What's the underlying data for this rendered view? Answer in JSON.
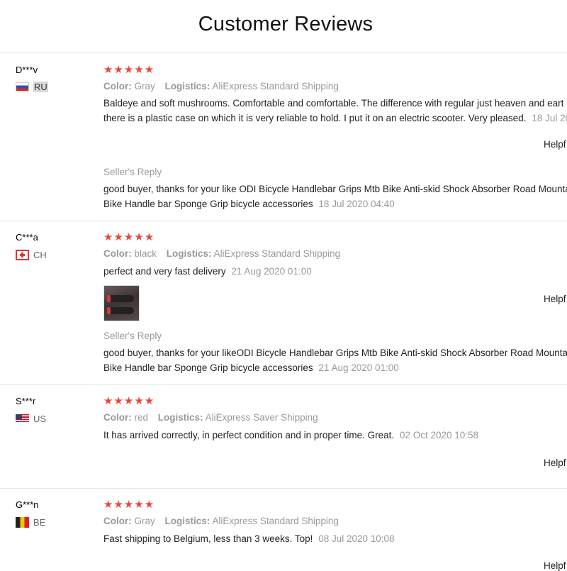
{
  "page": {
    "title": "Customer Reviews"
  },
  "labels": {
    "color": "Color:",
    "logistics": "Logistics:",
    "seller_reply": "Seller's Reply",
    "helpful": "Helpf"
  },
  "star_color": "#e8473b",
  "reviews": [
    {
      "user": "D***v",
      "country": "RU",
      "flag": "russia-flag",
      "stars": "★★★★★",
      "rating": 5,
      "color": "Gray",
      "logistics": "AliExpress Standard Shipping",
      "text_lines": [
        "Baldeye and soft mushrooms. Comfortable and comfortable. The difference with regular just heaven and eart",
        "there is a plastic case on which it is very reliable to hold. I put it on an electric scooter. Very pleased."
      ],
      "date": "18 Jul 20",
      "reply_lines": [
        "good buyer, thanks for your like ODI Bicycle Handlebar Grips Mtb Bike Anti-skid Shock Absorber Road Mounta",
        "Bike Handle bar Sponge Grip bicycle accessories"
      ],
      "reply_date": "18 Jul 2020 04:40"
    },
    {
      "user": "C***a",
      "country": "CH",
      "flag": "switzerland-flag",
      "stars": "★★★★★",
      "rating": 5,
      "color": "black",
      "logistics": "AliExpress Standard Shipping",
      "text_lines": [
        "perfect and very fast delivery"
      ],
      "date": "21 Aug 2020 01:00",
      "photo": "bike-grips-photo",
      "reply_lines": [
        "good buyer, thanks for your likeODI Bicycle Handlebar Grips Mtb Bike Anti-skid Shock Absorber Road Mounta",
        "Bike Handle bar Sponge Grip bicycle accessories"
      ],
      "reply_date": "21 Aug 2020 01:00"
    },
    {
      "user": "S***r",
      "country": "US",
      "flag": "usa-flag",
      "stars": "★★★★★",
      "rating": 5,
      "color": "red",
      "logistics": "AliExpress Saver Shipping",
      "text_lines": [
        "It has arrived correctly, in perfect condition and in proper time. Great."
      ],
      "date": "02 Oct 2020 10:58"
    },
    {
      "user": "G***n",
      "country": "BE",
      "flag": "belgium-flag",
      "stars": "★★★★★",
      "rating": 5,
      "color": "Gray",
      "logistics": "AliExpress Standard Shipping",
      "text_lines": [
        "Fast shipping to Belgium, less than 3 weeks. Top!"
      ],
      "date": "08 Jul 2020 10:08"
    }
  ]
}
